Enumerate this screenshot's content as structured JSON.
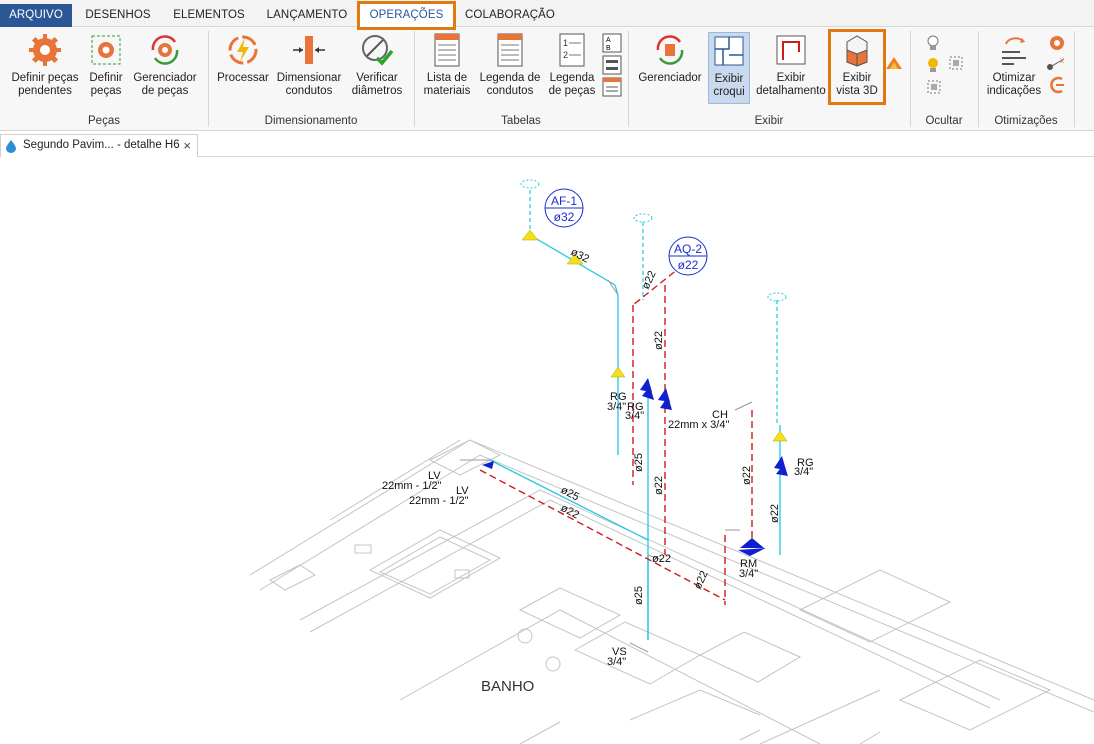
{
  "menu": {
    "tabs": [
      "ARQUIVO",
      "DESENHOS",
      "ELEMENTOS",
      "LANÇAMENTO",
      "OPERAÇÕES",
      "COLABORAÇÃO"
    ],
    "active": "OPERAÇÕES"
  },
  "ribbon": {
    "groups": {
      "pecas": "Peças",
      "dimensionamento": "Dimensionamento",
      "tabelas": "Tabelas",
      "exibir": "Exibir",
      "ocultar": "Ocultar",
      "otimizacoes": "Otimizações"
    },
    "buttons": {
      "definir_pendentes": [
        "Definir peças",
        "pendentes"
      ],
      "definir_pecas": [
        "Definir",
        "peças"
      ],
      "gerenciador_pecas": [
        "Gerenciador",
        "de peças"
      ],
      "processar": [
        "Processar"
      ],
      "dimensionar": [
        "Dimensionar",
        "condutos"
      ],
      "verificar": [
        "Verificar",
        "diâmetros"
      ],
      "lista_materiais": [
        "Lista de",
        "materiais"
      ],
      "legenda_condutos": [
        "Legenda de",
        "condutos"
      ],
      "legenda_pecas": [
        "Legenda",
        "de peças"
      ],
      "gerenciador": [
        "Gerenciador"
      ],
      "exibir_croqui": [
        "Exibir",
        "croqui"
      ],
      "exibir_detalhamento": [
        "Exibir",
        "detalhamento"
      ],
      "exibir_vista3d": [
        "Exibir",
        "vista 3D"
      ],
      "otimizar": [
        "Otimizar",
        "indicações"
      ]
    }
  },
  "document": {
    "tab_title": "Segundo Pavim... - detalhe H6",
    "close_glyph": "×"
  },
  "drawing": {
    "tags": [
      {
        "id": "AF-1",
        "dia": "ø32"
      },
      {
        "id": "AQ-2",
        "dia": "ø22"
      }
    ],
    "labels": {
      "d32": "ø32",
      "d22": "ø22",
      "d25": "ø25",
      "rg": "RG",
      "rg_size": "3/4\"",
      "ch": "CH",
      "ch_size": "22mm x 3/4\"",
      "lv": "LV",
      "lv_size": "22mm - 1/2\"",
      "rm": "RM",
      "rm_size": "3/4\"",
      "vs": "VS",
      "vs_size": "3/4\""
    },
    "room": "BANHO"
  },
  "colors": {
    "accent": "#e07a10",
    "file_tab": "#2b5797",
    "cold_pipe": "#22c8e0",
    "hot_pipe": "#d11a1a",
    "valve": "#1020d0",
    "marker": "#f2e01a"
  }
}
